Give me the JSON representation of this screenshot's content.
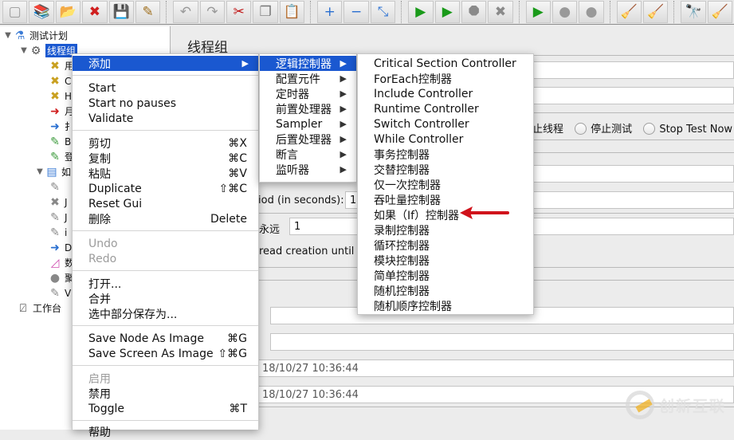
{
  "toolbar": {
    "buttons": [
      {
        "name": "new-icon",
        "glyph": "▢"
      },
      {
        "name": "templates-icon",
        "glyph": "📚"
      },
      {
        "name": "open-icon",
        "glyph": "📂"
      },
      {
        "name": "close-icon",
        "glyph": "✖"
      },
      {
        "name": "save-icon",
        "glyph": "💾"
      },
      {
        "name": "save-as-icon",
        "glyph": "✎"
      },
      {
        "name": "undo-icon",
        "glyph": "↶"
      },
      {
        "name": "redo-icon",
        "glyph": "↷"
      },
      {
        "name": "cut-icon",
        "glyph": "✂"
      },
      {
        "name": "copy-icon",
        "glyph": "❐"
      },
      {
        "name": "paste-icon",
        "glyph": "📋"
      },
      {
        "name": "expand-icon",
        "glyph": "+"
      },
      {
        "name": "collapse-icon",
        "glyph": "−"
      },
      {
        "name": "toggle-icon",
        "glyph": "⤡"
      },
      {
        "name": "start-icon",
        "glyph": "▶"
      },
      {
        "name": "start-no-pauses-icon",
        "glyph": "▶"
      },
      {
        "name": "stop-icon",
        "glyph": "⯃"
      },
      {
        "name": "shutdown-icon",
        "glyph": "✖"
      },
      {
        "name": "remote-start-icon",
        "glyph": "▶"
      },
      {
        "name": "remote-stop-icon",
        "glyph": "●"
      },
      {
        "name": "remote-shutdown-icon",
        "glyph": "●"
      },
      {
        "name": "clear-icon",
        "glyph": "🧹"
      },
      {
        "name": "clear-all-icon",
        "glyph": "🧹"
      },
      {
        "name": "search-icon",
        "glyph": "🔭"
      },
      {
        "name": "reset-search-icon",
        "glyph": "🧹"
      }
    ]
  },
  "tree": {
    "root": "测试计划",
    "thread_group": "线程组",
    "children_partial": [
      "用",
      "C",
      "H",
      "月",
      "扌",
      "B",
      "登",
      "如"
    ],
    "grandchildren_partial": [
      "",
      "J",
      "J",
      "i",
      "D",
      "数",
      "聚",
      "V"
    ],
    "workbench": "工作台"
  },
  "main": {
    "title": "线程组",
    "radio_labels": [
      "停止线程",
      "停止测试",
      "Stop Test Now"
    ],
    "ramp_label": "iod (in seconds):",
    "ramp_value": "1",
    "loop_label": "永远",
    "loop_value": "1",
    "delay_label": "read creation until n",
    "start_time": "18/10/27 10:36:44",
    "end_time": "18/10/27 10:36:44"
  },
  "context_menu": {
    "add": "添加",
    "start": "Start",
    "start_no_pauses": "Start no pauses",
    "validate": "Validate",
    "cut": {
      "label": "剪切",
      "shortcut": "⌘X"
    },
    "copy": {
      "label": "复制",
      "shortcut": "⌘C"
    },
    "paste": {
      "label": "粘贴",
      "shortcut": "⌘V"
    },
    "duplicate": {
      "label": "Duplicate",
      "shortcut": "⇧⌘C"
    },
    "reset_gui": "Reset Gui",
    "delete": {
      "label": "删除",
      "shortcut": "Delete"
    },
    "undo": "Undo",
    "redo": "Redo",
    "open": "打开...",
    "merge": "合并",
    "save_selection": "选中部分保存为...",
    "save_node_image": {
      "label": "Save Node As Image",
      "shortcut": "⌘G"
    },
    "save_screen_image": {
      "label": "Save Screen As Image",
      "shortcut": "⇧⌘G"
    },
    "enable": "启用",
    "disable": "禁用",
    "toggle": {
      "label": "Toggle",
      "shortcut": "⌘T"
    },
    "help": "帮助"
  },
  "add_submenu": [
    "逻辑控制器",
    "配置元件",
    "定时器",
    "前置处理器",
    "Sampler",
    "后置处理器",
    "断言",
    "监听器"
  ],
  "logic_submenu": [
    "Critical Section Controller",
    "ForEach控制器",
    "Include Controller",
    "Runtime Controller",
    "Switch Controller",
    "While Controller",
    "事务控制器",
    "交替控制器",
    "仅一次控制器",
    "吞吐量控制器",
    "如果（If）控制器",
    "录制控制器",
    "循环控制器",
    "模块控制器",
    "简单控制器",
    "随机控制器",
    "随机顺序控制器"
  ],
  "annotation": {
    "target": "如果（If）控制器",
    "color": "#d0121b"
  },
  "watermark": "创新互联",
  "colors": {
    "highlight": "#1a58d0",
    "annotation_arrow": "#d0121b"
  }
}
